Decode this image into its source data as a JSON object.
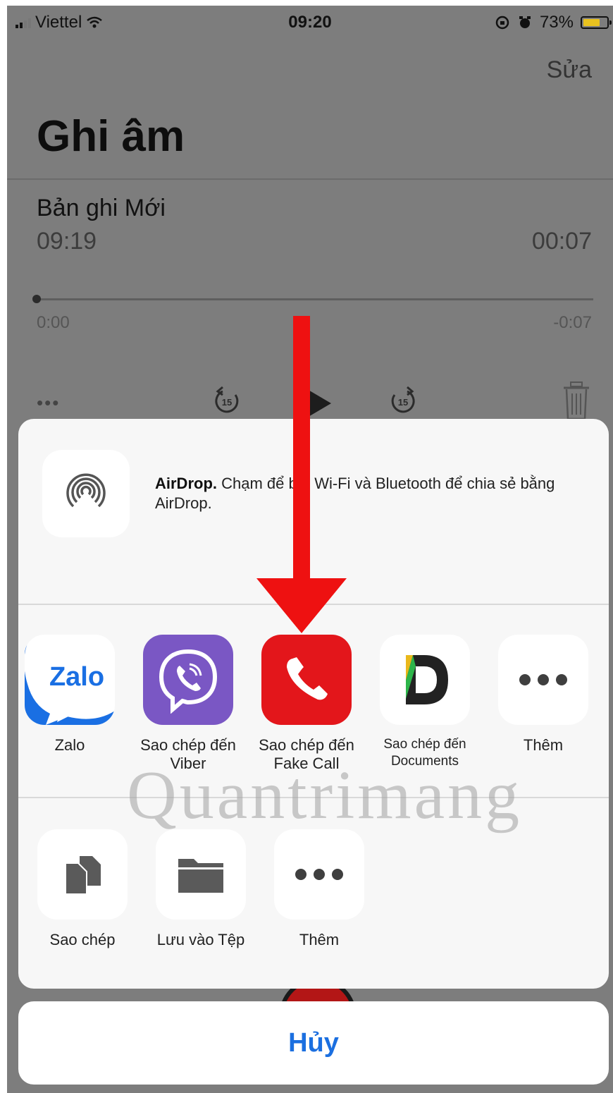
{
  "status_bar": {
    "carrier": "Viettel",
    "time": "09:20",
    "battery": "73%",
    "battery_level": 0.73
  },
  "header": {
    "edit_label": "Sửa",
    "title": "Ghi âm"
  },
  "recording": {
    "name": "Bản ghi Mới",
    "timestamp": "09:19",
    "duration": "00:07",
    "elapsed": "0:00",
    "remaining": "-0:07",
    "skip_seconds": "15"
  },
  "share_sheet": {
    "airdrop_title": "AirDrop.",
    "airdrop_desc": "Chạm để bật Wi-Fi và Bluetooth để chia sẻ bằng AirDrop.",
    "apps": [
      {
        "label": "Zalo",
        "icon": "zalo-icon"
      },
      {
        "label": "Sao chép đến Viber",
        "icon": "viber-icon"
      },
      {
        "label": "Sao chép đến Fake Call",
        "icon": "phone-icon"
      },
      {
        "label": "Sao chép đến Documents",
        "icon": "documents-icon"
      },
      {
        "label": "Thêm",
        "icon": "more-icon"
      }
    ],
    "zalo_logo_text": "Zalo",
    "actions": [
      {
        "label": "Sao chép",
        "icon": "copy-icon"
      },
      {
        "label": "Lưu vào Tệp",
        "icon": "folder-icon"
      },
      {
        "label": "Thêm",
        "icon": "more-icon"
      }
    ],
    "cancel_label": "Hủy"
  },
  "watermark": "Quantrimang",
  "colors": {
    "accent": "#1b6fe0",
    "arrow": "#ee1111",
    "fake_call": "#e3161b",
    "viber": "#7a57c4",
    "zalo": "#1a6fe3"
  }
}
